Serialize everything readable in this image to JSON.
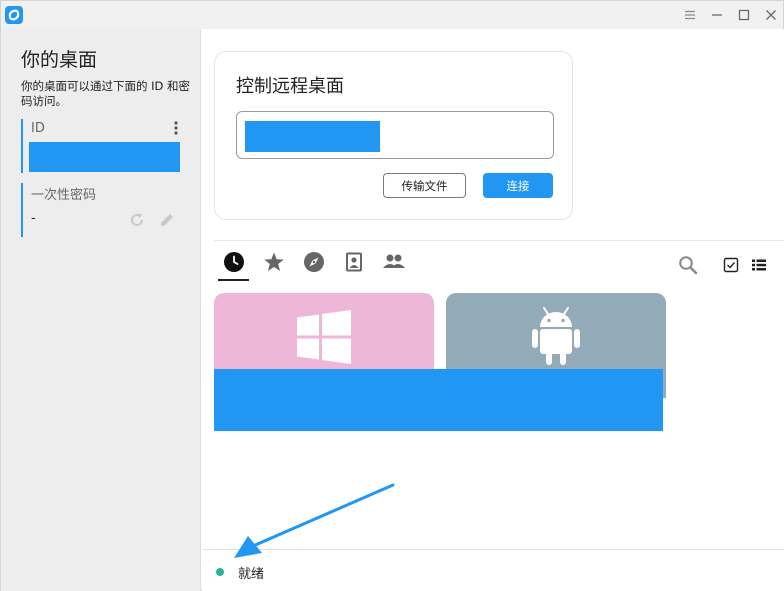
{
  "window": {
    "controls": [
      "menu-icon",
      "minimize-icon",
      "maximize-icon",
      "close-icon"
    ],
    "accent_color": "#2196f3"
  },
  "sidebar": {
    "title": "你的桌面",
    "description": "你的桌面可以通过下面的 ID 和密码访问。",
    "id_label": "ID",
    "password_label": "一次性密码",
    "password_value": "-"
  },
  "connect": {
    "title": "控制远程桌面",
    "transfer_button": "传输文件",
    "connect_button": "连接"
  },
  "tabs": [
    "recent-sessions-icon",
    "favorites-icon",
    "discovered-icon",
    "address-book-icon",
    "group-icon"
  ],
  "toolbar": [
    "search-icon",
    "select-icon",
    "list-view-icon"
  ],
  "peers": [
    {
      "os": "windows",
      "color": "#efb7d7"
    },
    {
      "os": "android",
      "color": "#93aab9"
    }
  ],
  "status": {
    "text": "就绪",
    "dot_color": "#2bb39a"
  }
}
